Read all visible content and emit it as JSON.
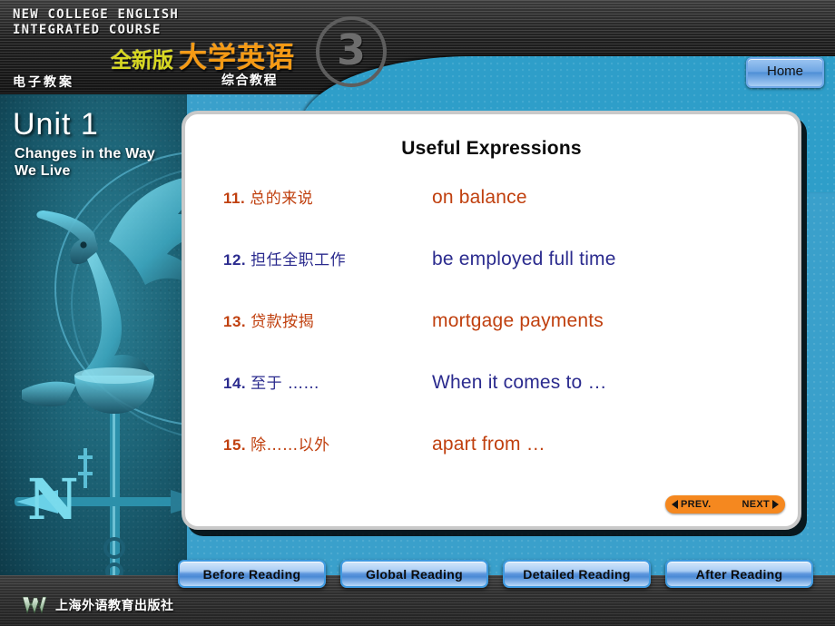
{
  "header": {
    "english_line1": "NEW COLLEGE ENGLISH",
    "english_line2": "INTEGRATED COURSE",
    "english_block": "NEW COLLEGE ENGLISH\nINTEGRATED COURSE",
    "cn_label": "电子教案",
    "brand_new": "全新版",
    "brand_main": "大学英语",
    "brand_sub": "综合教程",
    "volume": "3",
    "home_label": "Home",
    "colors": {
      "brand_new": "#d8d820",
      "brand_main": "#f59a14",
      "stripe_dark": "#2b2b2b"
    }
  },
  "sidebar": {
    "unit": "Unit 1",
    "unit_subtitle": "Changes in the Way\nWe Live",
    "vane_direction_label": "N",
    "accent_color": "#1d6477"
  },
  "card": {
    "title": "Useful Expressions",
    "expressions": [
      {
        "number": "11.",
        "chinese": "总的来说",
        "english": "on balance",
        "color": "#c0400f"
      },
      {
        "number": "12.",
        "chinese": "担任全职工作",
        "english": "be employed  full  time",
        "color": "#2b2b8e"
      },
      {
        "number": "13.",
        "chinese": "贷款按揭",
        "english": "mortgage payments",
        "color": "#c0400f"
      },
      {
        "number": "14.",
        "chinese": "至于 ……",
        "english": "When it comes to …",
        "color": "#2b2b8e"
      },
      {
        "number": "15.",
        "chinese": "除……以外",
        "english": "apart from …",
        "color": "#c0400f"
      }
    ],
    "pager": {
      "prev_label": "PREV.",
      "next_label": "NEXT",
      "background": "#f5881f"
    }
  },
  "navbar": {
    "buttons": [
      {
        "label": "Before Reading"
      },
      {
        "label": "Global Reading"
      },
      {
        "label": "Detailed Reading"
      },
      {
        "label": "After Reading"
      }
    ]
  },
  "footer": {
    "publisher": "上海外语教育出版社",
    "logo_letter": "W"
  },
  "theme": {
    "page_blue": "#3aa0cb",
    "card_border": "#c9c9c9",
    "nav_button_border": "#3f9ae0"
  }
}
